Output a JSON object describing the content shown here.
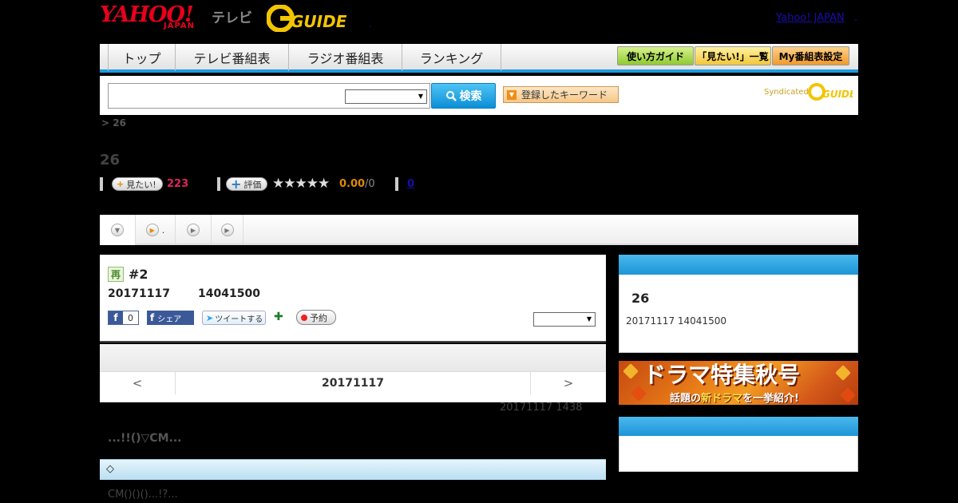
{
  "header": {
    "logo_yahoo": "YAHOO!",
    "logo_japan": "JAPAN",
    "logo_tv": "テレビ",
    "logo_gguide": "G GUIDE",
    "yahoo_link": "Yahoo! JAPAN",
    "yahoo_link_dot": ".",
    "header_dot": "."
  },
  "nav": {
    "tabs": [
      "トップ",
      "テレビ番組表",
      "ラジオ番組表",
      "ランキング"
    ],
    "guide_buttons": [
      "使い方ガイド",
      "「見たい!」一覧",
      "My番組表設定"
    ]
  },
  "search": {
    "button_label": "検索",
    "keyword_button": "登録したキーワード",
    "syndicated": "Syndicated"
  },
  "program": {
    "breadcrumb": "> 26",
    "title": "26",
    "want_label": "見たい!",
    "want_count": "223",
    "rate_label": "評価",
    "stars": "★★★★★",
    "score": "0.00",
    "score_total": "/0",
    "zero_link": "0"
  },
  "tabs_row": {
    "items": [
      "",
      ".",
      "",
      ""
    ]
  },
  "episode": {
    "badge": "再",
    "title": "#2",
    "date": "20171117",
    "time": "14041500",
    "fb_like_count": "0",
    "fb_share": "シェア",
    "tweet": "ツイートする",
    "reserve": "予約"
  },
  "date_nav": {
    "prev": "<",
    "date": "20171117",
    "next": ">"
  },
  "content": {
    "update_note": "20171117  1438",
    "heading": "...!!()▽CM...",
    "section_label": "◇",
    "body": "CM()()()...!?..."
  },
  "sidebar": {
    "box1_title": "26",
    "box1_sub": "20171117  14041500",
    "banner_main": "ドラマ特集秋号",
    "banner_sub_1": "話題の",
    "banner_sub_hl": "新ドラマ",
    "banner_sub_2": "を一挙紹介!"
  },
  "colors": {
    "accent_blue": "#1a9be0",
    "want_pink": "#e0245e",
    "score_orange": "#e08a00"
  }
}
